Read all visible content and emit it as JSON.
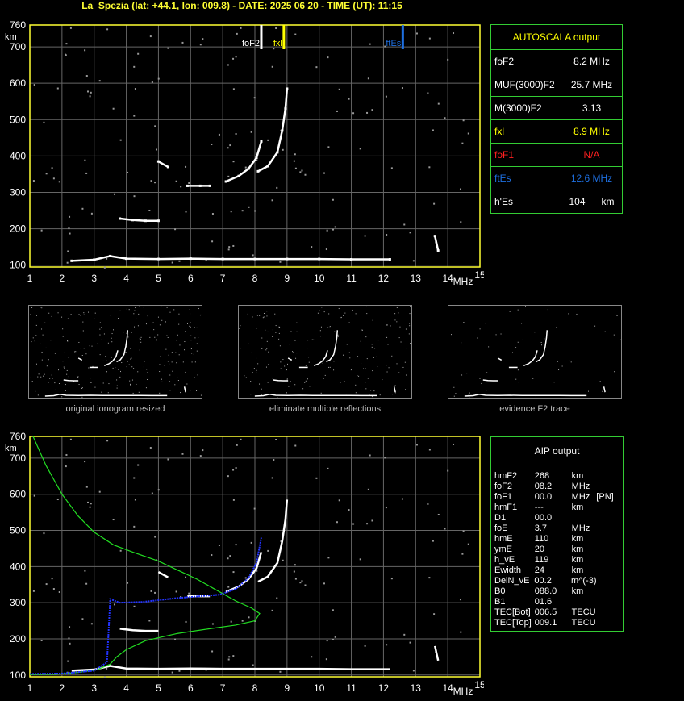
{
  "title": "La_Spezia (lat: +44.1, lon: 009.8) - DATE: 2025 06 20 - TIME (UT): 11:15",
  "colors": {
    "white": "#ffffff",
    "yellow": "#ffff00",
    "blue": "#1e6fe0",
    "green": "#33cc33",
    "red": "#ff2020",
    "profile_green": "#22dd22",
    "profile_blue": "#2233ff"
  },
  "chart_data": [
    {
      "type": "scatter",
      "xlabel": "MHz",
      "ylabel": "km",
      "xlim": [
        1,
        15
      ],
      "ylim": [
        95,
        760
      ],
      "x_ticks": [
        "1",
        "2",
        "3",
        "4",
        "5",
        "6",
        "7",
        "8",
        "9",
        "10",
        "11",
        "12",
        "13",
        "14",
        "15"
      ],
      "y_ticks": [
        "100",
        "200",
        "300",
        "400",
        "500",
        "600",
        "700",
        "760"
      ],
      "markers": [
        {
          "name": "foF2",
          "x": 8.2,
          "color": "#ffffff"
        },
        {
          "name": "fxl",
          "x": 8.9,
          "color": "#ffff00"
        },
        {
          "name": "ftEs",
          "x": 12.6,
          "color": "#1e6fe0"
        }
      ],
      "traces": [
        {
          "name": "E-trace",
          "points": [
            [
              2.3,
              112
            ],
            [
              3.0,
              115
            ],
            [
              3.5,
              125
            ],
            [
              4.0,
              118
            ],
            [
              5.0,
              117
            ],
            [
              6.0,
              118
            ],
            [
              7.0,
              117
            ],
            [
              8.0,
              117
            ],
            [
              9.0,
              117
            ],
            [
              10.0,
              117
            ],
            [
              11.0,
              116
            ],
            [
              12.2,
              116
            ]
          ]
        },
        {
          "name": "Es-second-hop",
          "points": [
            [
              3.8,
              228
            ],
            [
              4.2,
              224
            ],
            [
              4.6,
              222
            ],
            [
              5.0,
              222
            ]
          ]
        },
        {
          "name": "F1-segment",
          "points": [
            [
              5.0,
              385
            ],
            [
              5.3,
              370
            ]
          ]
        },
        {
          "name": "F-plateau",
          "points": [
            [
              5.9,
              318
            ],
            [
              6.3,
              318
            ],
            [
              6.6,
              318
            ]
          ]
        },
        {
          "name": "O-trace",
          "points": [
            [
              7.1,
              330
            ],
            [
              7.5,
              345
            ],
            [
              7.8,
              365
            ],
            [
              8.05,
              395
            ],
            [
              8.2,
              440
            ]
          ]
        },
        {
          "name": "X-trace",
          "points": [
            [
              8.1,
              358
            ],
            [
              8.4,
              372
            ],
            [
              8.7,
              410
            ],
            [
              8.85,
              470
            ],
            [
              8.95,
              530
            ],
            [
              9.0,
              585
            ]
          ]
        },
        {
          "name": "spike",
          "points": [
            [
              13.6,
              180
            ],
            [
              13.7,
              140
            ]
          ]
        }
      ]
    },
    {
      "type": "line",
      "xlabel": "MHz",
      "ylabel": "km",
      "xlim": [
        1,
        15
      ],
      "ylim": [
        95,
        760
      ],
      "x_ticks": [
        "1",
        "2",
        "3",
        "4",
        "5",
        "6",
        "7",
        "8",
        "9",
        "10",
        "11",
        "12",
        "13",
        "14",
        "15"
      ],
      "y_ticks": [
        "100",
        "200",
        "300",
        "400",
        "500",
        "600",
        "700",
        "760"
      ],
      "series": [
        {
          "points": [
            [
              1.1,
              760
            ],
            [
              1.5,
              680
            ],
            [
              2.0,
              600
            ],
            [
              2.5,
              540
            ],
            [
              3.0,
              495
            ],
            [
              3.6,
              460
            ],
            [
              4.2,
              440
            ],
            [
              5.0,
              415
            ],
            [
              5.6,
              390
            ],
            [
              6.2,
              365
            ],
            [
              6.8,
              335
            ],
            [
              7.4,
              305
            ],
            [
              7.9,
              285
            ],
            [
              8.15,
              270
            ],
            [
              8.0,
              250
            ],
            [
              7.4,
              238
            ],
            [
              6.6,
              228
            ],
            [
              5.6,
              215
            ],
            [
              4.6,
              195
            ],
            [
              4.0,
              170
            ],
            [
              3.7,
              150
            ],
            [
              3.5,
              130
            ],
            [
              3.1,
              115
            ],
            [
              2.5,
              107
            ],
            [
              1.8,
              102
            ],
            [
              1.0,
              101
            ]
          ]
        },
        {
          "points": [
            [
              1.0,
              103
            ],
            [
              2.0,
              104
            ],
            [
              3.0,
              112
            ],
            [
              3.4,
              135
            ],
            [
              3.5,
              310
            ],
            [
              3.8,
              300
            ],
            [
              4.5,
              302
            ],
            [
              5.5,
              312
            ],
            [
              6.3,
              318
            ],
            [
              6.9,
              322
            ],
            [
              7.4,
              338
            ],
            [
              7.8,
              368
            ],
            [
              8.05,
              410
            ],
            [
              8.2,
              480
            ]
          ]
        }
      ]
    }
  ],
  "autoscala": {
    "title": "AUTOSCALA output",
    "rows": [
      {
        "label": "foF2",
        "value": "8.2 MHz",
        "color": "#ffffff"
      },
      {
        "label": "MUF(3000)F2",
        "value": "25.7 MHz",
        "color": "#ffffff"
      },
      {
        "label": "M(3000)F2",
        "value": "3.13",
        "color": "#ffffff"
      },
      {
        "label": "fxl",
        "value": "8.9 MHz",
        "color": "#ffff00"
      },
      {
        "label": "foF1",
        "value": "N/A",
        "color": "#ff2020"
      },
      {
        "label": "ftEs",
        "value": "12.6 MHz",
        "color": "#1e6fe0"
      },
      {
        "label": "h'Es",
        "value": "104",
        "unit": "km",
        "color": "#ffffff"
      }
    ]
  },
  "thumbnails": [
    {
      "caption": "original ionogram resized"
    },
    {
      "caption": "eliminate multiple reflections"
    },
    {
      "caption": "evidence F2 trace"
    }
  ],
  "aip": {
    "title": "AIP output",
    "rows": [
      [
        "hmF2",
        "268",
        "km",
        ""
      ],
      [
        "foF2",
        "08.2",
        "MHz",
        ""
      ],
      [
        "foF1",
        "00.0",
        "MHz",
        "[PN]"
      ],
      [
        "hmF1",
        "---",
        "km",
        ""
      ],
      [
        "D1",
        "00.0",
        "",
        ""
      ],
      [
        "foE",
        "3.7",
        "MHz",
        ""
      ],
      [
        "hmE",
        "110",
        "km",
        ""
      ],
      [
        "ymE",
        "20",
        "km",
        ""
      ],
      [
        "h_vE",
        "119",
        "km",
        ""
      ],
      [
        "Ewidth",
        "24",
        "km",
        ""
      ],
      [
        "DelN_vE",
        "00.2",
        "m^(-3)",
        ""
      ],
      [
        "B0",
        "088.0",
        "km",
        ""
      ],
      [
        "B1",
        "01.6",
        "",
        ""
      ],
      [
        "TEC[Bot]",
        "006.5",
        "TECU",
        ""
      ],
      [
        "TEC[Top]",
        "009.1",
        "TECU",
        ""
      ]
    ]
  }
}
